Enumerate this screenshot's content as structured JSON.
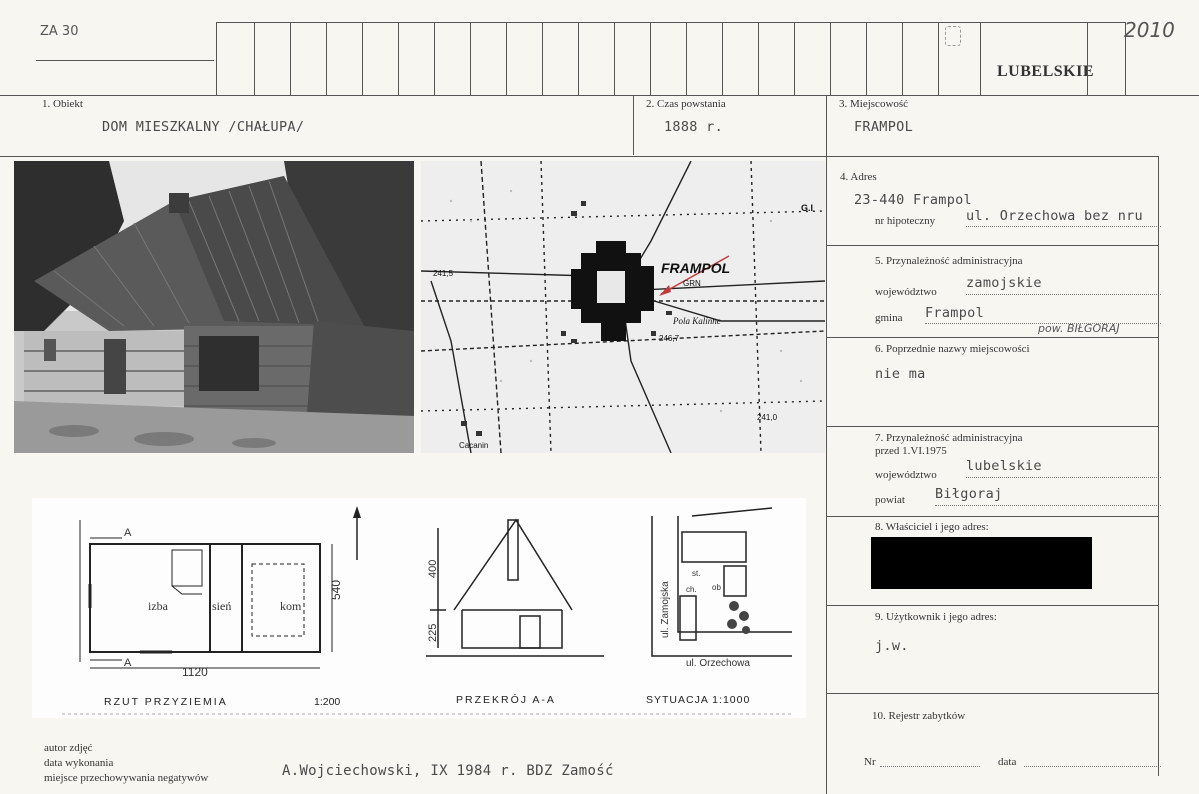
{
  "card": {
    "code": "ZA 30",
    "number": "2010",
    "region": "LUBELSKIE"
  },
  "fields": {
    "f1": {
      "label": "1. Obiekt",
      "value": "DOM MIESZKALNY /CHAŁUPA/"
    },
    "f2": {
      "label": "2. Czas powstania",
      "value": "1888 r."
    },
    "f3": {
      "label": "3. Miejscowość",
      "value": "FRAMPOL"
    },
    "f4": {
      "label": "4. Adres",
      "value": "23-440 Frampol",
      "sub_label": "nr hipoteczny",
      "sub_value": "ul. Orzechowa bez nru"
    },
    "f5": {
      "label": "5. Przynależność administracyjna",
      "voiv_label": "województwo",
      "voiv_value": "zamojskie",
      "gmina_label": "gmina",
      "gmina_value": "Frampol",
      "note": "pow. BIŁGORAJ"
    },
    "f6": {
      "label": "6. Poprzednie nazwy miejscowości",
      "value": "nie ma"
    },
    "f7": {
      "label": "7. Przynależność administracyjna",
      "label2": "przed 1.VI.1975",
      "voiv_label": "województwo",
      "voiv_value": "lubelskie",
      "powiat_label": "powiat",
      "powiat_value": "Biłgoraj"
    },
    "f8": {
      "label": "8. Właściciel i jego adres:"
    },
    "f9": {
      "label": "9. Użytkownik i jego adres:",
      "value": "j.w."
    },
    "f10": {
      "label": "10. Rejestr zabytków",
      "nr_label": "Nr",
      "data_label": "data"
    }
  },
  "footer": {
    "line1": "autor zdjęć",
    "line2": "data wykonania",
    "line3": "miejsce przechowywania negatywów",
    "value": "A.Wojciechowski, IX 1984 r. BDZ  Zamość"
  },
  "map": {
    "town": "FRAMPOL",
    "grn": "GRN",
    "pola": "Pola Kalinne",
    "elev1": "241,5",
    "elev2": "246,7",
    "elev3": "241,0",
    "village": "Cacanin",
    "corner": "G.I"
  },
  "drawing": {
    "plan_caption": "RZUT  PRZYZIEMIA",
    "plan_scale": "1:200",
    "section_caption": "PRZEKRÓJ  A-A",
    "site_caption": "SYTUACJA  1:1000",
    "izba": "izba",
    "sien": "sień",
    "kom": "kom",
    "dim_w": "1120",
    "dim_h": "540",
    "dim_400": "400",
    "dim_225": "225",
    "a_top": "A",
    "a_bottom": "A",
    "street1": "ul. Zamojska",
    "street2": "ul. Orzechowa",
    "st": "st.",
    "ob": "ob",
    "ch": "ch."
  }
}
